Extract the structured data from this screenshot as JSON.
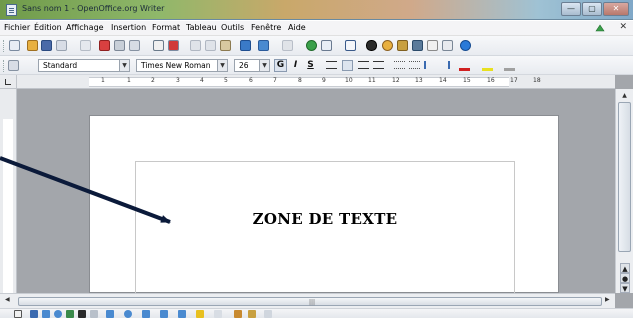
{
  "window": {
    "title": "Sans nom 1 - OpenOffice.org Writer",
    "buttons": {
      "minimize": "—",
      "maximize": "▢",
      "close": "✕"
    }
  },
  "menubar": {
    "items": [
      "Fichier",
      "Édition",
      "Affichage",
      "Insertion",
      "Format",
      "Tableau",
      "Outils",
      "Fenêtre",
      "Aide"
    ],
    "close_document": "✕"
  },
  "formatting": {
    "paragraph_style": "Standard",
    "font_name": "Times New Roman",
    "font_size": "26",
    "bold": "G",
    "italic": "I",
    "underline": "S"
  },
  "ruler": {
    "numbers": [
      "1",
      "1",
      "2",
      "3",
      "4",
      "5",
      "6",
      "7",
      "8",
      "9",
      "10",
      "11",
      "12",
      "13",
      "14",
      "15",
      "16",
      "17",
      "18"
    ]
  },
  "document": {
    "frame_text": "ZONE DE TEXTE"
  },
  "colors": {
    "workspace": "#a3a6ab",
    "page": "#ffffff",
    "arrow": "#0b1a3a"
  }
}
